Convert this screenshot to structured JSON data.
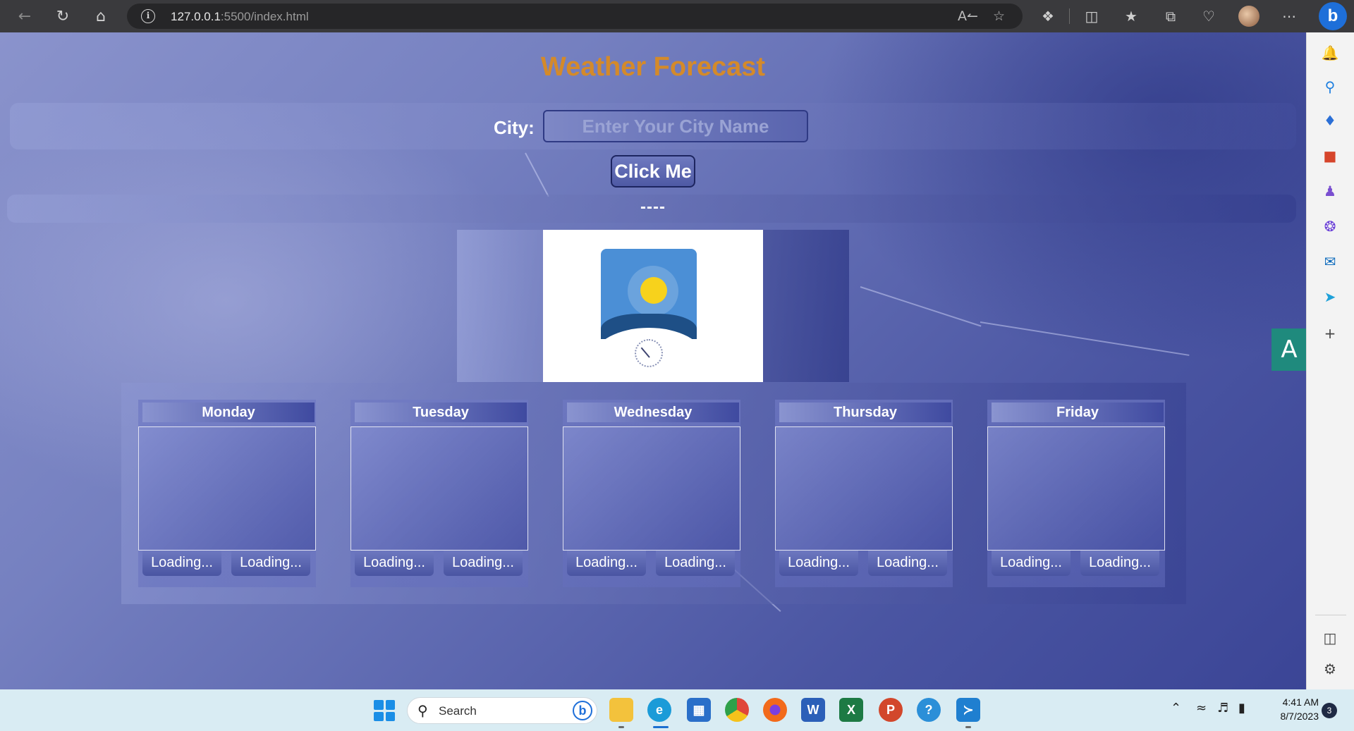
{
  "browser": {
    "url_host": "127.0.0.1",
    "url_rest": ":5500/index.html"
  },
  "page": {
    "title": "Weather Forecast",
    "city_label": "City:",
    "city_placeholder": "Enter Your City Name",
    "city_value": "",
    "button_label": "Click Me",
    "result_text": "----"
  },
  "forecast": {
    "days": [
      {
        "name": "Monday",
        "left": "Loading...",
        "right": "Loading..."
      },
      {
        "name": "Tuesday",
        "left": "Loading...",
        "right": "Loading..."
      },
      {
        "name": "Wednesday",
        "left": "Loading...",
        "right": "Loading..."
      },
      {
        "name": "Thursday",
        "left": "Loading...",
        "right": "Loading..."
      },
      {
        "name": "Friday",
        "left": "Loading...",
        "right": "Loading..."
      }
    ]
  },
  "taskbar": {
    "search_label": "Search",
    "time": "4:41 AM",
    "date": "8/7/2023",
    "notifications": "3"
  },
  "colors": {
    "title": "#d48a2a",
    "background": "#5d68b0",
    "taskbar": "#d9ecf3"
  },
  "icons": {
    "toolbar": [
      "back-icon",
      "refresh-icon",
      "home-icon",
      "info-icon",
      "read-aloud-icon",
      "favorite-star-icon",
      "extensions-icon",
      "split-screen-icon",
      "favorites-icon",
      "collections-icon",
      "browser-essentials-icon",
      "more-icon",
      "bing-icon"
    ],
    "sidebar": [
      "notification-icon",
      "search-icon",
      "shopping-icon",
      "tools-icon",
      "games-icon",
      "copilot-icon",
      "outlook-icon",
      "send-icon",
      "add-icon",
      "sidebar-toggle-icon",
      "settings-icon"
    ],
    "taskbar": [
      "windows-start-icon",
      "file-explorer-icon",
      "edge-icon",
      "store-icon",
      "chrome-icon",
      "firefox-icon",
      "word-icon",
      "excel-icon",
      "powerpoint-icon",
      "feedback-icon",
      "vscode-icon"
    ]
  }
}
